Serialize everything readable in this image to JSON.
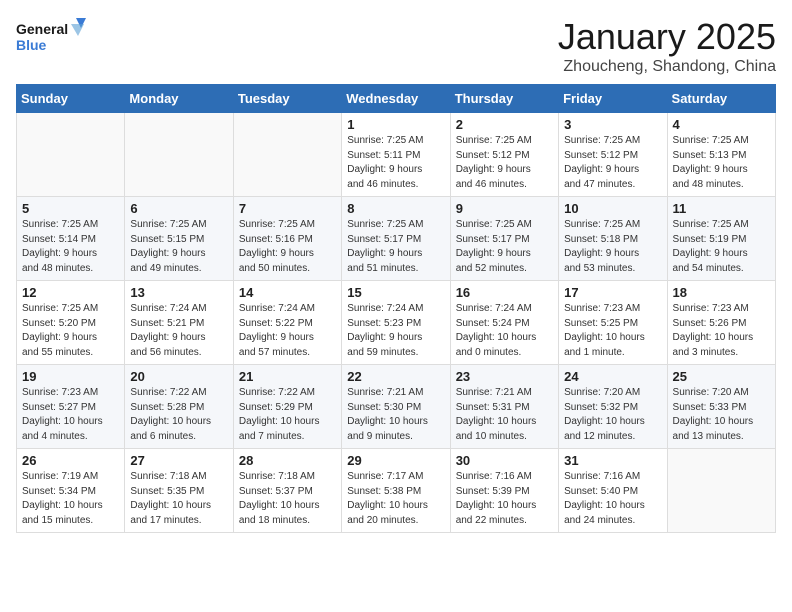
{
  "logo": {
    "line1": "General",
    "line2": "Blue"
  },
  "title": "January 2025",
  "subtitle": "Zhoucheng, Shandong, China",
  "header_days": [
    "Sunday",
    "Monday",
    "Tuesday",
    "Wednesday",
    "Thursday",
    "Friday",
    "Saturday"
  ],
  "weeks": [
    [
      {
        "day": "",
        "info": ""
      },
      {
        "day": "",
        "info": ""
      },
      {
        "day": "",
        "info": ""
      },
      {
        "day": "1",
        "info": "Sunrise: 7:25 AM\nSunset: 5:11 PM\nDaylight: 9 hours\nand 46 minutes."
      },
      {
        "day": "2",
        "info": "Sunrise: 7:25 AM\nSunset: 5:12 PM\nDaylight: 9 hours\nand 46 minutes."
      },
      {
        "day": "3",
        "info": "Sunrise: 7:25 AM\nSunset: 5:12 PM\nDaylight: 9 hours\nand 47 minutes."
      },
      {
        "day": "4",
        "info": "Sunrise: 7:25 AM\nSunset: 5:13 PM\nDaylight: 9 hours\nand 48 minutes."
      }
    ],
    [
      {
        "day": "5",
        "info": "Sunrise: 7:25 AM\nSunset: 5:14 PM\nDaylight: 9 hours\nand 48 minutes."
      },
      {
        "day": "6",
        "info": "Sunrise: 7:25 AM\nSunset: 5:15 PM\nDaylight: 9 hours\nand 49 minutes."
      },
      {
        "day": "7",
        "info": "Sunrise: 7:25 AM\nSunset: 5:16 PM\nDaylight: 9 hours\nand 50 minutes."
      },
      {
        "day": "8",
        "info": "Sunrise: 7:25 AM\nSunset: 5:17 PM\nDaylight: 9 hours\nand 51 minutes."
      },
      {
        "day": "9",
        "info": "Sunrise: 7:25 AM\nSunset: 5:17 PM\nDaylight: 9 hours\nand 52 minutes."
      },
      {
        "day": "10",
        "info": "Sunrise: 7:25 AM\nSunset: 5:18 PM\nDaylight: 9 hours\nand 53 minutes."
      },
      {
        "day": "11",
        "info": "Sunrise: 7:25 AM\nSunset: 5:19 PM\nDaylight: 9 hours\nand 54 minutes."
      }
    ],
    [
      {
        "day": "12",
        "info": "Sunrise: 7:25 AM\nSunset: 5:20 PM\nDaylight: 9 hours\nand 55 minutes."
      },
      {
        "day": "13",
        "info": "Sunrise: 7:24 AM\nSunset: 5:21 PM\nDaylight: 9 hours\nand 56 minutes."
      },
      {
        "day": "14",
        "info": "Sunrise: 7:24 AM\nSunset: 5:22 PM\nDaylight: 9 hours\nand 57 minutes."
      },
      {
        "day": "15",
        "info": "Sunrise: 7:24 AM\nSunset: 5:23 PM\nDaylight: 9 hours\nand 59 minutes."
      },
      {
        "day": "16",
        "info": "Sunrise: 7:24 AM\nSunset: 5:24 PM\nDaylight: 10 hours\nand 0 minutes."
      },
      {
        "day": "17",
        "info": "Sunrise: 7:23 AM\nSunset: 5:25 PM\nDaylight: 10 hours\nand 1 minute."
      },
      {
        "day": "18",
        "info": "Sunrise: 7:23 AM\nSunset: 5:26 PM\nDaylight: 10 hours\nand 3 minutes."
      }
    ],
    [
      {
        "day": "19",
        "info": "Sunrise: 7:23 AM\nSunset: 5:27 PM\nDaylight: 10 hours\nand 4 minutes."
      },
      {
        "day": "20",
        "info": "Sunrise: 7:22 AM\nSunset: 5:28 PM\nDaylight: 10 hours\nand 6 minutes."
      },
      {
        "day": "21",
        "info": "Sunrise: 7:22 AM\nSunset: 5:29 PM\nDaylight: 10 hours\nand 7 minutes."
      },
      {
        "day": "22",
        "info": "Sunrise: 7:21 AM\nSunset: 5:30 PM\nDaylight: 10 hours\nand 9 minutes."
      },
      {
        "day": "23",
        "info": "Sunrise: 7:21 AM\nSunset: 5:31 PM\nDaylight: 10 hours\nand 10 minutes."
      },
      {
        "day": "24",
        "info": "Sunrise: 7:20 AM\nSunset: 5:32 PM\nDaylight: 10 hours\nand 12 minutes."
      },
      {
        "day": "25",
        "info": "Sunrise: 7:20 AM\nSunset: 5:33 PM\nDaylight: 10 hours\nand 13 minutes."
      }
    ],
    [
      {
        "day": "26",
        "info": "Sunrise: 7:19 AM\nSunset: 5:34 PM\nDaylight: 10 hours\nand 15 minutes."
      },
      {
        "day": "27",
        "info": "Sunrise: 7:18 AM\nSunset: 5:35 PM\nDaylight: 10 hours\nand 17 minutes."
      },
      {
        "day": "28",
        "info": "Sunrise: 7:18 AM\nSunset: 5:37 PM\nDaylight: 10 hours\nand 18 minutes."
      },
      {
        "day": "29",
        "info": "Sunrise: 7:17 AM\nSunset: 5:38 PM\nDaylight: 10 hours\nand 20 minutes."
      },
      {
        "day": "30",
        "info": "Sunrise: 7:16 AM\nSunset: 5:39 PM\nDaylight: 10 hours\nand 22 minutes."
      },
      {
        "day": "31",
        "info": "Sunrise: 7:16 AM\nSunset: 5:40 PM\nDaylight: 10 hours\nand 24 minutes."
      },
      {
        "day": "",
        "info": ""
      }
    ]
  ]
}
